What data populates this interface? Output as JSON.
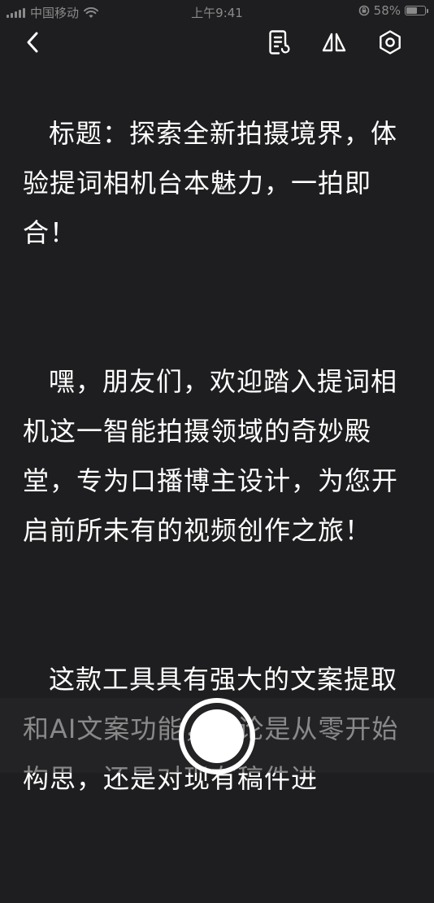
{
  "status_bar": {
    "carrier": "中国移动",
    "time": "上午9:41",
    "battery": "58%",
    "battery_level": 0.58
  },
  "toolbar": {
    "back_icon": "chevron-left-icon",
    "script_icon": "document-edit-icon",
    "mirror_icon": "mirror-flip-icon",
    "settings_icon": "gear-icon"
  },
  "script": {
    "paragraphs": [
      "标题：探索全新拍摄境界，体验提词相机台本魅力，一拍即合！",
      "嘿，朋友们，欢迎踏入提词相机这一智能拍摄领域的奇妙殿堂，专为口播博主设计，为您开启前所未有的视频创作之旅！",
      "这款工具具有强大的文案提取和AI文案功能，无论是从零开始构思，还是对现有稿件进"
    ]
  },
  "colors": {
    "background": "#1e1e20",
    "text": "#ffffff",
    "status_text": "#8a8a8a"
  }
}
